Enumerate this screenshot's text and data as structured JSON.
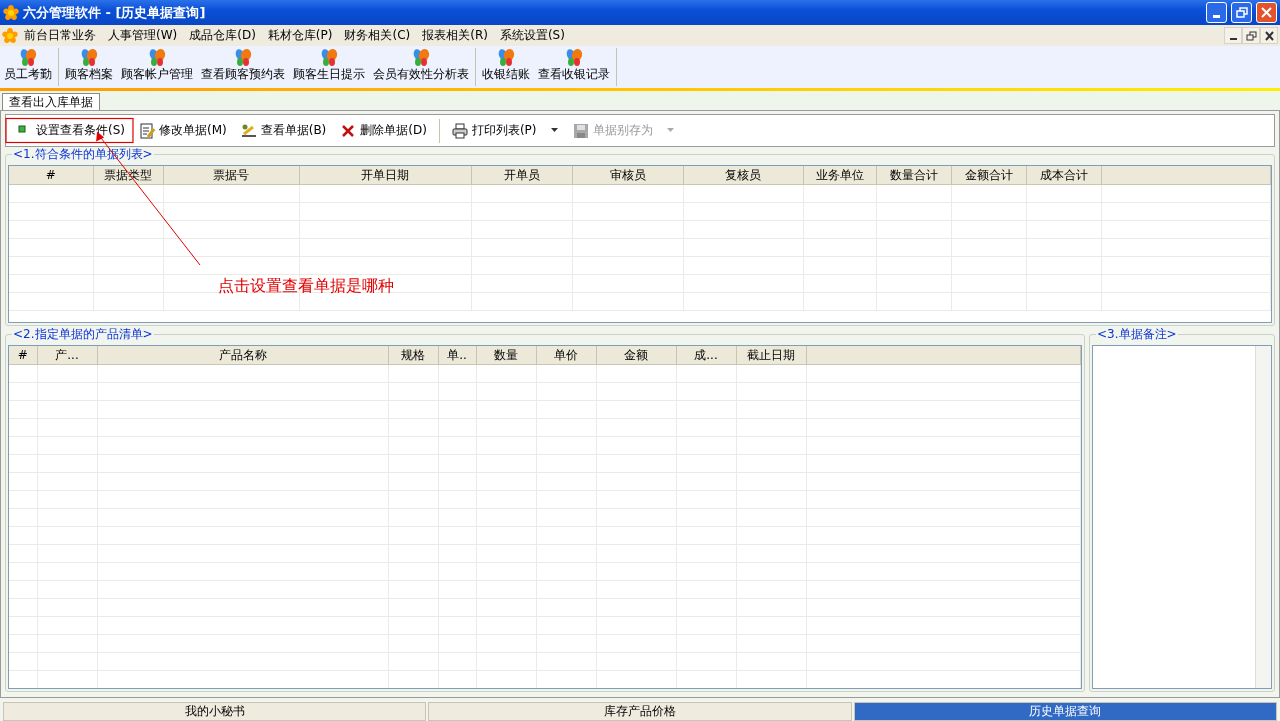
{
  "window": {
    "title": "六分管理软件 - [历史单据查询]"
  },
  "menu": [
    "前台日常业务",
    "人事管理(W)",
    "成品仓库(D)",
    "耗材仓库(P)",
    "财务相关(C)",
    "报表相关(R)",
    "系统设置(S)"
  ],
  "toolbar": {
    "groups": [
      [
        "员工考勤"
      ],
      [
        "顾客档案",
        "顾客帐户管理",
        "查看顾客预约表",
        "顾客生日提示",
        "会员有效性分析表"
      ],
      [
        "收银结账",
        "查看收银记录"
      ]
    ]
  },
  "doc_tabs": [
    {
      "label": "查看出入库单据",
      "selected": true
    }
  ],
  "actions": [
    {
      "label": "设置查看条件(S)",
      "kind": "button",
      "disabled": false
    },
    {
      "label": "修改单据(M)",
      "kind": "button",
      "disabled": false
    },
    {
      "label": "查看单据(B)",
      "kind": "button",
      "disabled": false
    },
    {
      "label": "删除单据(D)",
      "kind": "button",
      "disabled": false
    },
    {
      "label": "打印列表(P)",
      "kind": "split",
      "disabled": false
    },
    {
      "label": "单据别存为",
      "kind": "split",
      "disabled": true
    }
  ],
  "bill_list": {
    "title": "<1.符合条件的单据列表>",
    "columns": [
      "#",
      "票据类型",
      "票据号",
      "开单日期",
      "开单员",
      "审核员",
      "复核员",
      "业务单位",
      "数量合计",
      "金额合计",
      "成本合计"
    ]
  },
  "product_list": {
    "title": "<2.指定单据的产品清单>",
    "columns": [
      "#",
      "产...",
      "产品名称",
      "规格",
      "单..",
      "数量",
      "单价",
      "金额",
      "成...",
      "截止日期"
    ]
  },
  "notes": {
    "title": "<3.单据备注>"
  },
  "annotation": {
    "text": "点击设置查看单据是哪种"
  },
  "bottom_tabs": [
    {
      "label": "我的小秘书",
      "selected": false
    },
    {
      "label": "库存产品价格",
      "selected": false
    },
    {
      "label": "历史单据查询",
      "selected": true
    }
  ]
}
